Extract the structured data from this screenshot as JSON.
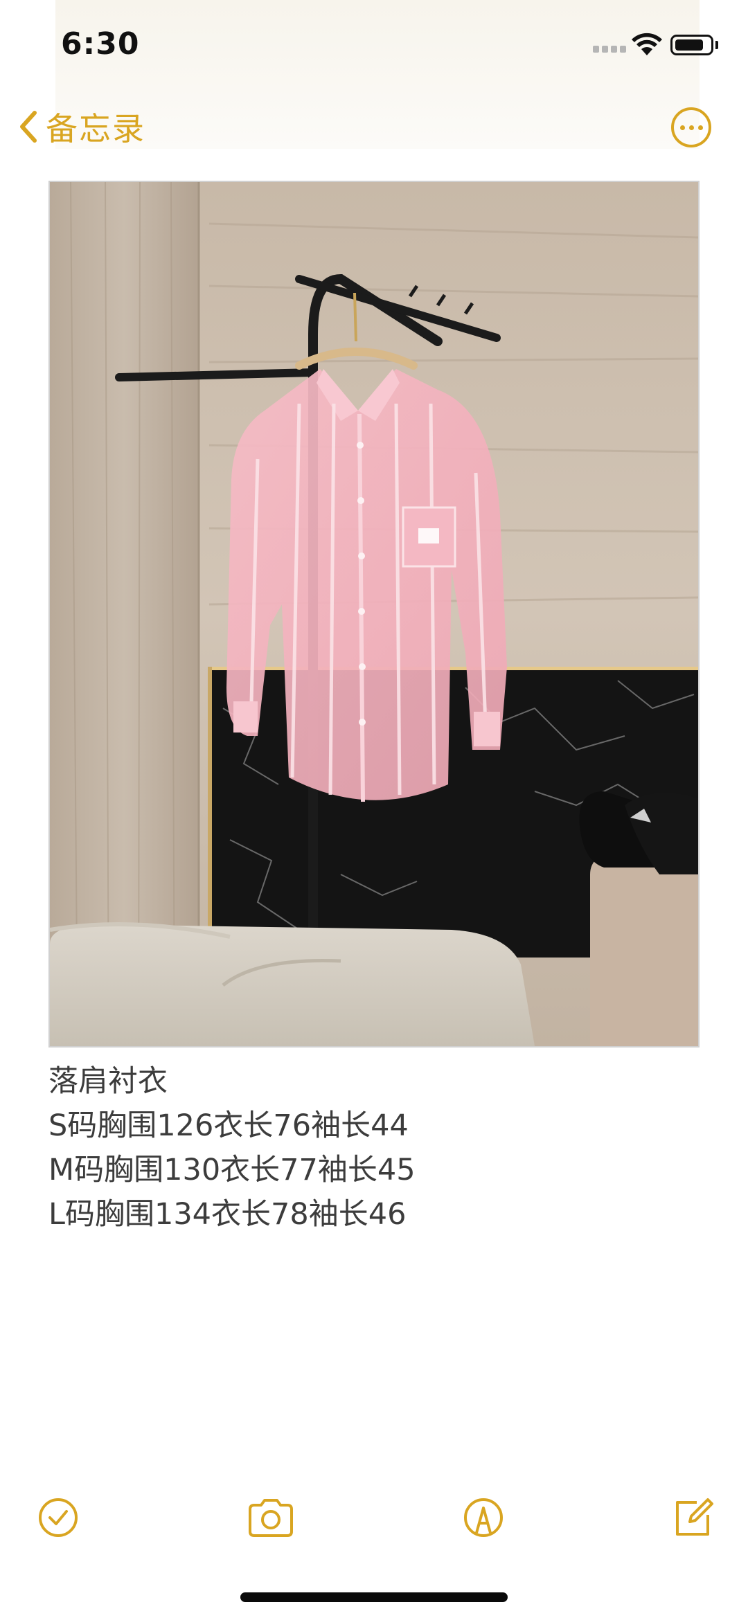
{
  "status_bar": {
    "time": "6:30",
    "signal_icon": "cellular-signal-icon",
    "wifi_icon": "wifi-icon",
    "battery_icon": "battery-icon"
  },
  "nav": {
    "back_label": "备忘录",
    "back_icon": "chevron-left-icon",
    "more_icon": "ellipsis-circle-icon"
  },
  "note": {
    "image_description_icon": "photo-pink-sheer-striped-shirt",
    "lines": [
      "落肩衬衣",
      "S码胸围126衣长76袖长44",
      "M码胸围130衣长77袖长45",
      "L码胸围134衣长78袖长46"
    ]
  },
  "toolbar": {
    "checklist_icon": "checkmark-circle-icon",
    "camera_icon": "camera-icon",
    "markup_icon": "pen-markup-icon",
    "compose_icon": "compose-icon"
  },
  "colors": {
    "accent": "#d9a521",
    "text": "#3c3c3c",
    "background": "#ffffff"
  }
}
